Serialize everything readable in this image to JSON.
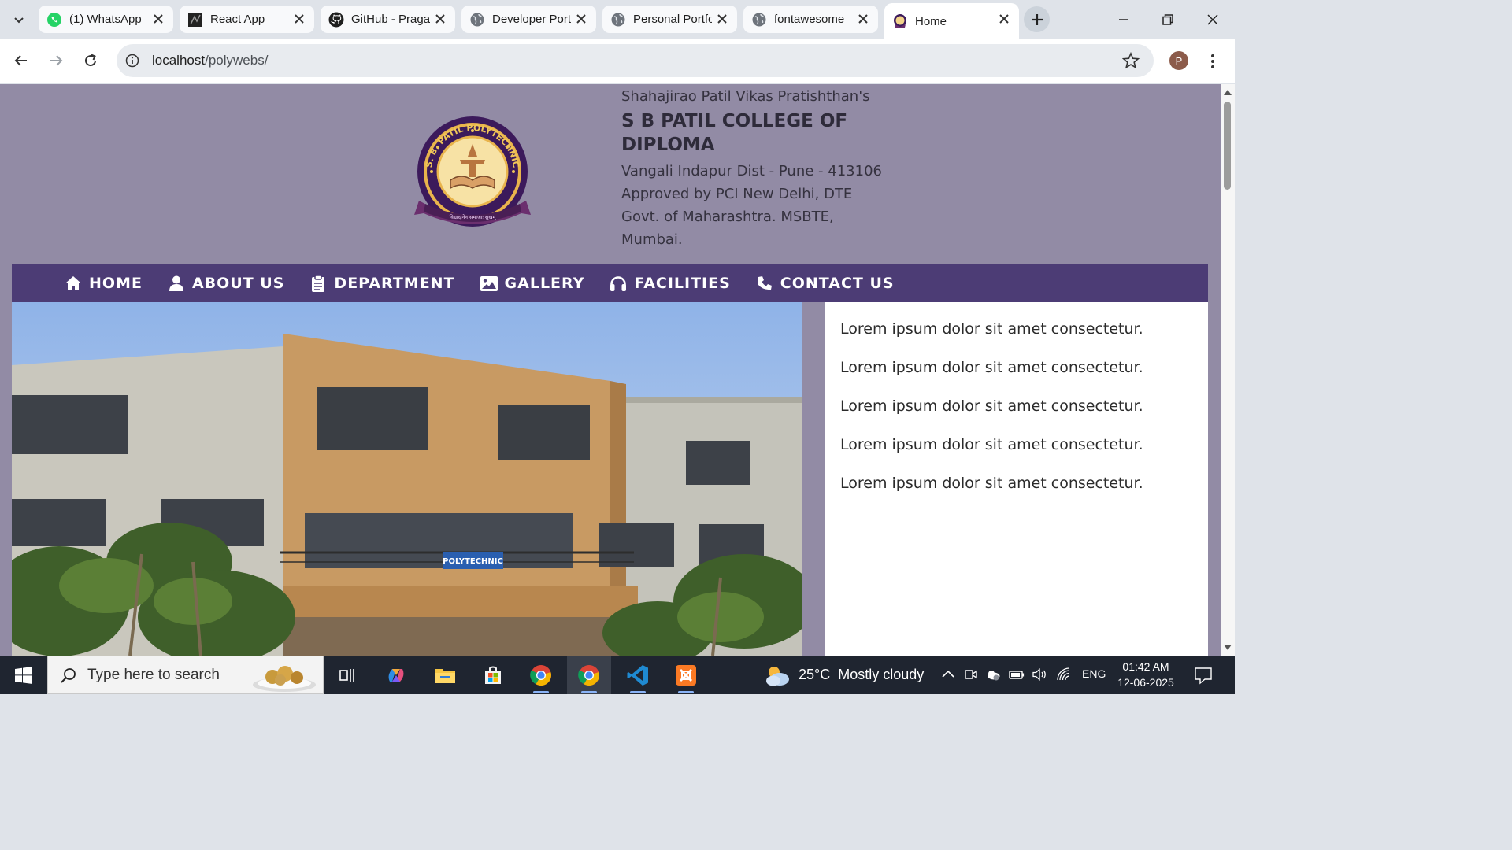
{
  "browser": {
    "tabs": [
      {
        "title": "(1) WhatsApp",
        "favicon": "whatsapp-icon"
      },
      {
        "title": "React App",
        "favicon": "react-app-icon"
      },
      {
        "title": "GitHub - Pragati",
        "favicon": "github-icon"
      },
      {
        "title": "Developer Portfolio",
        "favicon": "globe-icon"
      },
      {
        "title": "Personal Portfolio",
        "favicon": "globe-icon"
      },
      {
        "title": "fontawesome",
        "favicon": "globe-icon"
      },
      {
        "title": "Home",
        "favicon": "college-logo-icon",
        "active": true
      }
    ],
    "url_host": "localhost",
    "url_path": "/polywebs/",
    "profile_initial": "P"
  },
  "header": {
    "trust": "Shahajirao Patil Vikas Pratishthan's",
    "college": "S B PATIL COLLEGE OF DIPLOMA",
    "address_lines": [
      "Vangali Indapur Dist - Pune - 413106",
      "Approved by PCI New Delhi, DTE",
      "Govt. of Maharashtra. MSBTE,",
      "Mumbai."
    ],
    "logo_text": {
      "ring": "S. B. PATIL POLYTECHNIC",
      "motto": "विद्यादानेन समाजाः सुखम्"
    }
  },
  "nav": [
    {
      "label": "HOME",
      "icon": "house-icon"
    },
    {
      "label": "ABOUT US",
      "icon": "user-icon"
    },
    {
      "label": "DEPARTMENT",
      "icon": "clipboard-icon"
    },
    {
      "label": "GALLERY",
      "icon": "image-icon"
    },
    {
      "label": "FACILITIES",
      "icon": "headphones-icon"
    },
    {
      "label": "CONTACT US",
      "icon": "phone-icon"
    }
  ],
  "hero": {
    "sign_text": "POLYTECHNIC"
  },
  "sidebar": {
    "items": [
      "Lorem ipsum dolor sit amet consectetur.",
      "Lorem ipsum dolor sit amet consectetur.",
      "Lorem ipsum dolor sit amet consectetur.",
      "Lorem ipsum dolor sit amet consectetur.",
      "Lorem ipsum dolor sit amet consectetur."
    ]
  },
  "taskbar": {
    "search_placeholder": "Type here to search",
    "weather_temp": "25°C",
    "weather_condition": "Mostly cloudy",
    "language": "ENG",
    "time": "01:42 AM",
    "date": "12-06-2025"
  },
  "colors": {
    "page_background": "#928ba5",
    "nav_background": "#4c3c75",
    "logo_purple": "#3c1a5b",
    "logo_gold": "#e9b44c"
  }
}
